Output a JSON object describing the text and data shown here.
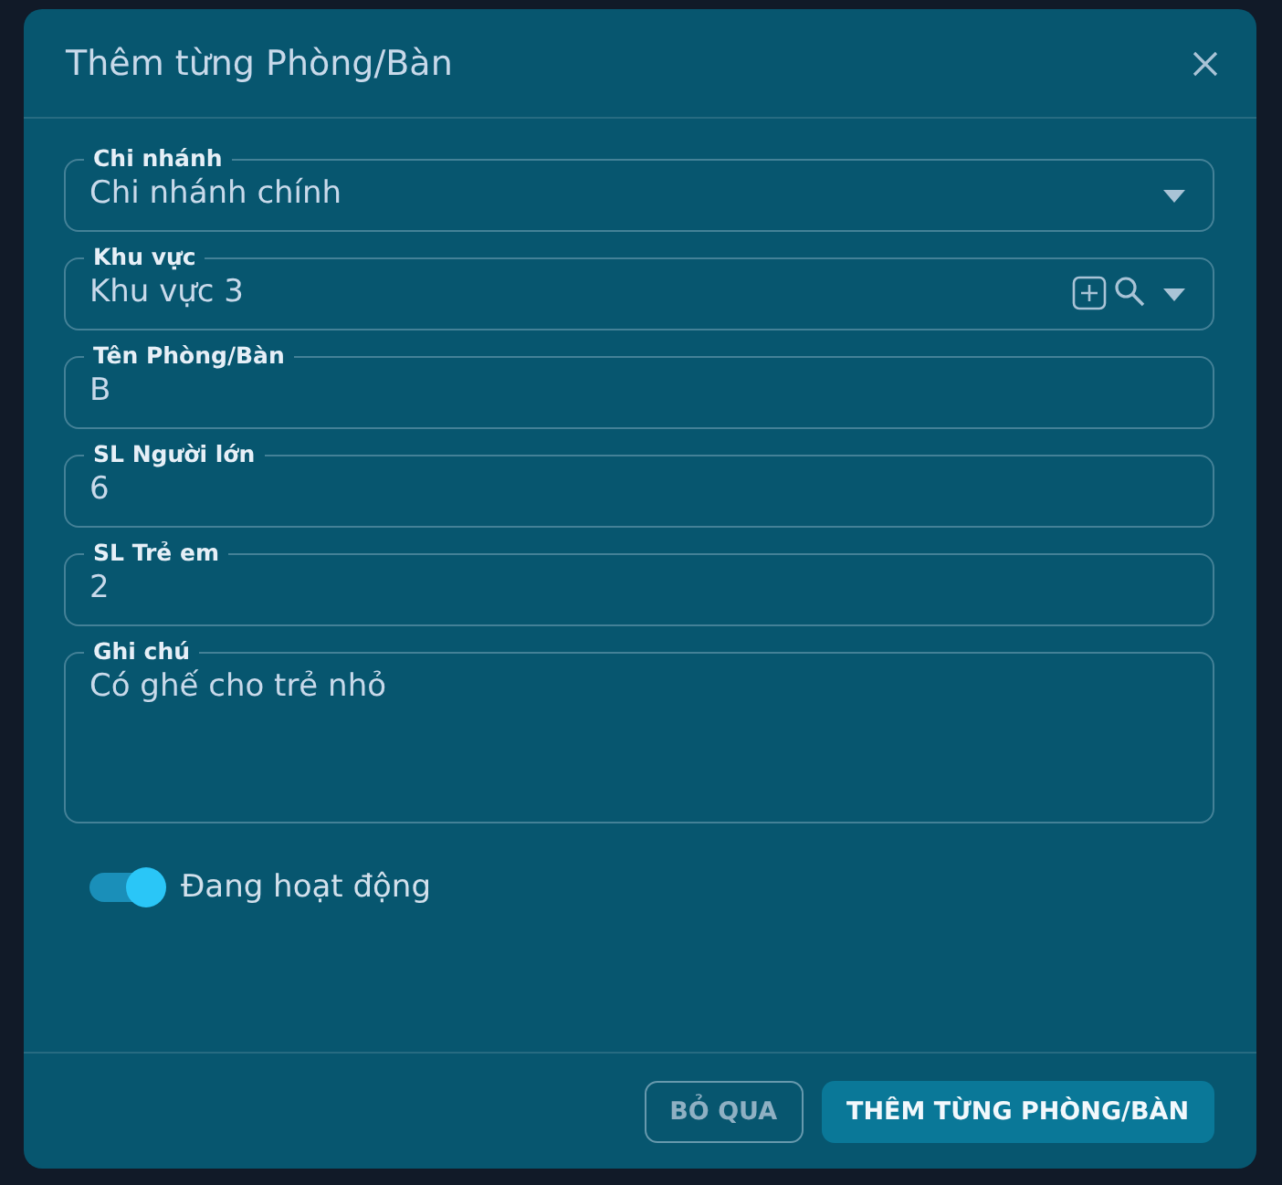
{
  "dialog": {
    "title": "Thêm từng Phòng/Bàn",
    "fields": [
      {
        "kind": "select",
        "label": "Chi nhánh",
        "value": "Chi nhánh chính"
      },
      {
        "kind": "select_search",
        "label": "Khu vực",
        "value": "Khu vực 3"
      },
      {
        "kind": "input",
        "label": "Tên Phòng/Bàn",
        "value": "B"
      },
      {
        "kind": "input",
        "label": "SL Người lớn",
        "value": "6"
      },
      {
        "kind": "input",
        "label": "SL Trẻ em",
        "value": "2"
      },
      {
        "kind": "textarea",
        "label": "Ghi chú",
        "value": "Có ghế cho trẻ nhỏ"
      }
    ],
    "toggle": {
      "label": "Đang hoạt động",
      "on": true
    },
    "buttons": [
      {
        "kind": "outline",
        "label": "BỎ QUA"
      },
      {
        "kind": "primary",
        "label": "THÊM TỪNG PHÒNG/BÀN"
      }
    ]
  }
}
